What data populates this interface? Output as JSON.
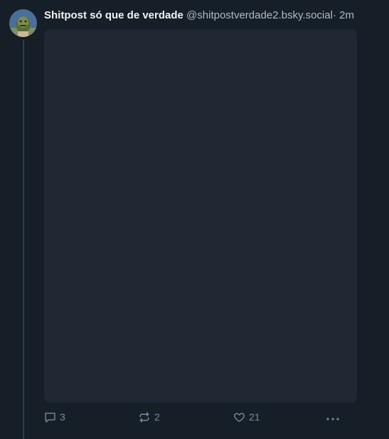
{
  "post": {
    "author": {
      "display_name": "Shitpost só que de verdade",
      "handle": "@shitpostverdade2.bsky.social"
    },
    "separator": "·",
    "time": "2m",
    "actions": {
      "reply_count": "3",
      "repost_count": "2",
      "like_count": "21"
    }
  },
  "icons": {
    "reply": "speech-bubble-icon",
    "repost": "repost-arrows-icon",
    "like": "heart-icon",
    "more": "ellipsis-icon"
  },
  "colors": {
    "background": "#161e27",
    "media_placeholder": "#1f2833",
    "thread_line": "#2b3d55",
    "muted_text": "#788ca0",
    "handle_text": "#aebbc9"
  }
}
